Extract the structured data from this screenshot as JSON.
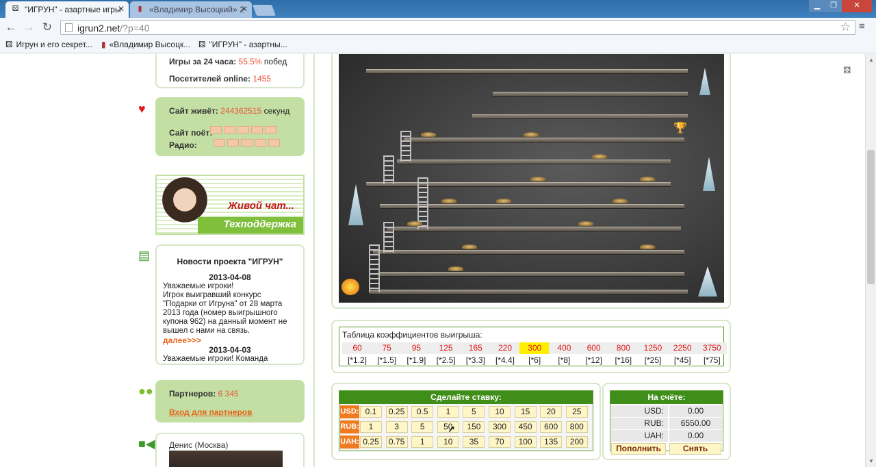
{
  "browser": {
    "tabs": [
      {
        "title": "\"ИГРУН\" - азартные игры",
        "active": true,
        "icon": "dice-icon"
      },
      {
        "title": "«Владимир Высоцкий» 2",
        "active": false,
        "icon": "radio-icon"
      }
    ],
    "window_controls": [
      "minimize",
      "restore",
      "close"
    ],
    "url_host": "igrun2.net",
    "url_path": "/?p=40",
    "bookmarks": [
      {
        "label": "Игрун и его секрет...",
        "icon": "dice-icon"
      },
      {
        "label": "«Владимир Высоцк...",
        "icon": "radio-icon"
      },
      {
        "label": "\"ИГРУН\" - азартны...",
        "icon": "dice-icon"
      }
    ]
  },
  "sidebar": {
    "stats": {
      "games_label": "Игры за 24 часа:",
      "games_value": "55.5%",
      "games_suffix": "побед",
      "visitors_label": "Посетителей online:",
      "visitors_value": "1455"
    },
    "site_alive": {
      "label": "Сайт живёт:",
      "value": "244362515",
      "suffix": "секунд",
      "sings_label": "Сайт поёт:",
      "radio_label": "Радио:"
    },
    "chat": {
      "title": "Живой чат...",
      "subtitle": "Техподдержка"
    },
    "news": {
      "title": "Новости проекта \"ИГРУН\"",
      "items": [
        {
          "date": "2013-04-08",
          "text": "Уважаемые игроки!\nИгрок выигравший конкурс \"Подарки от Игруна\" от 28 марта 2013 года (номер выигрышного купона 962) на данный момент не вышел с нами на связь.",
          "more": "далее>>>"
        },
        {
          "date": "2013-04-03",
          "text": "Уважаемые игроки! Команда"
        }
      ]
    },
    "partners": {
      "label": "Партнеров:",
      "value": "6 345",
      "link": "Вход для партнеров"
    },
    "video": {
      "caption": "Денис (Москва)"
    }
  },
  "coef_table": {
    "title": "Таблица коэффициентов выигрыша:",
    "values": [
      "60",
      "75",
      "95",
      "125",
      "165",
      "220",
      "300",
      "400",
      "600",
      "800",
      "1250",
      "2250",
      "3750"
    ],
    "multipliers": [
      "[*1.2]",
      "[*1.5]",
      "[*1.9]",
      "[*2.5]",
      "[*3.3]",
      "[*4.4]",
      "[*6]",
      "[*8]",
      "[*12]",
      "[*16]",
      "[*25]",
      "[*45]",
      "[*75]"
    ],
    "highlight_index": 6
  },
  "bet": {
    "title": "Сделайте ставку:",
    "rows": [
      {
        "currency": "USD:",
        "values": [
          "0.1",
          "0.25",
          "0.5",
          "1",
          "5",
          "10",
          "15",
          "20",
          "25"
        ]
      },
      {
        "currency": "RUB:",
        "values": [
          "1",
          "3",
          "5",
          "50",
          "150",
          "300",
          "450",
          "600",
          "800"
        ]
      },
      {
        "currency": "UAH:",
        "values": [
          "0.25",
          "0.75",
          "1",
          "10",
          "35",
          "70",
          "100",
          "135",
          "200"
        ]
      }
    ]
  },
  "account": {
    "title": "На счёте:",
    "rows": [
      {
        "label": "USD:",
        "value": "0.00"
      },
      {
        "label": "RUB:",
        "value": "6550.00"
      },
      {
        "label": "UAH:",
        "value": "0.00"
      }
    ],
    "deposit": "Пополнить",
    "withdraw": "Снять"
  },
  "colors": {
    "accent_green": "#3f8e1a",
    "value_red": "#e8563a",
    "highlight_yellow": "#ffee00",
    "currency_orange": "#f07a1e"
  }
}
